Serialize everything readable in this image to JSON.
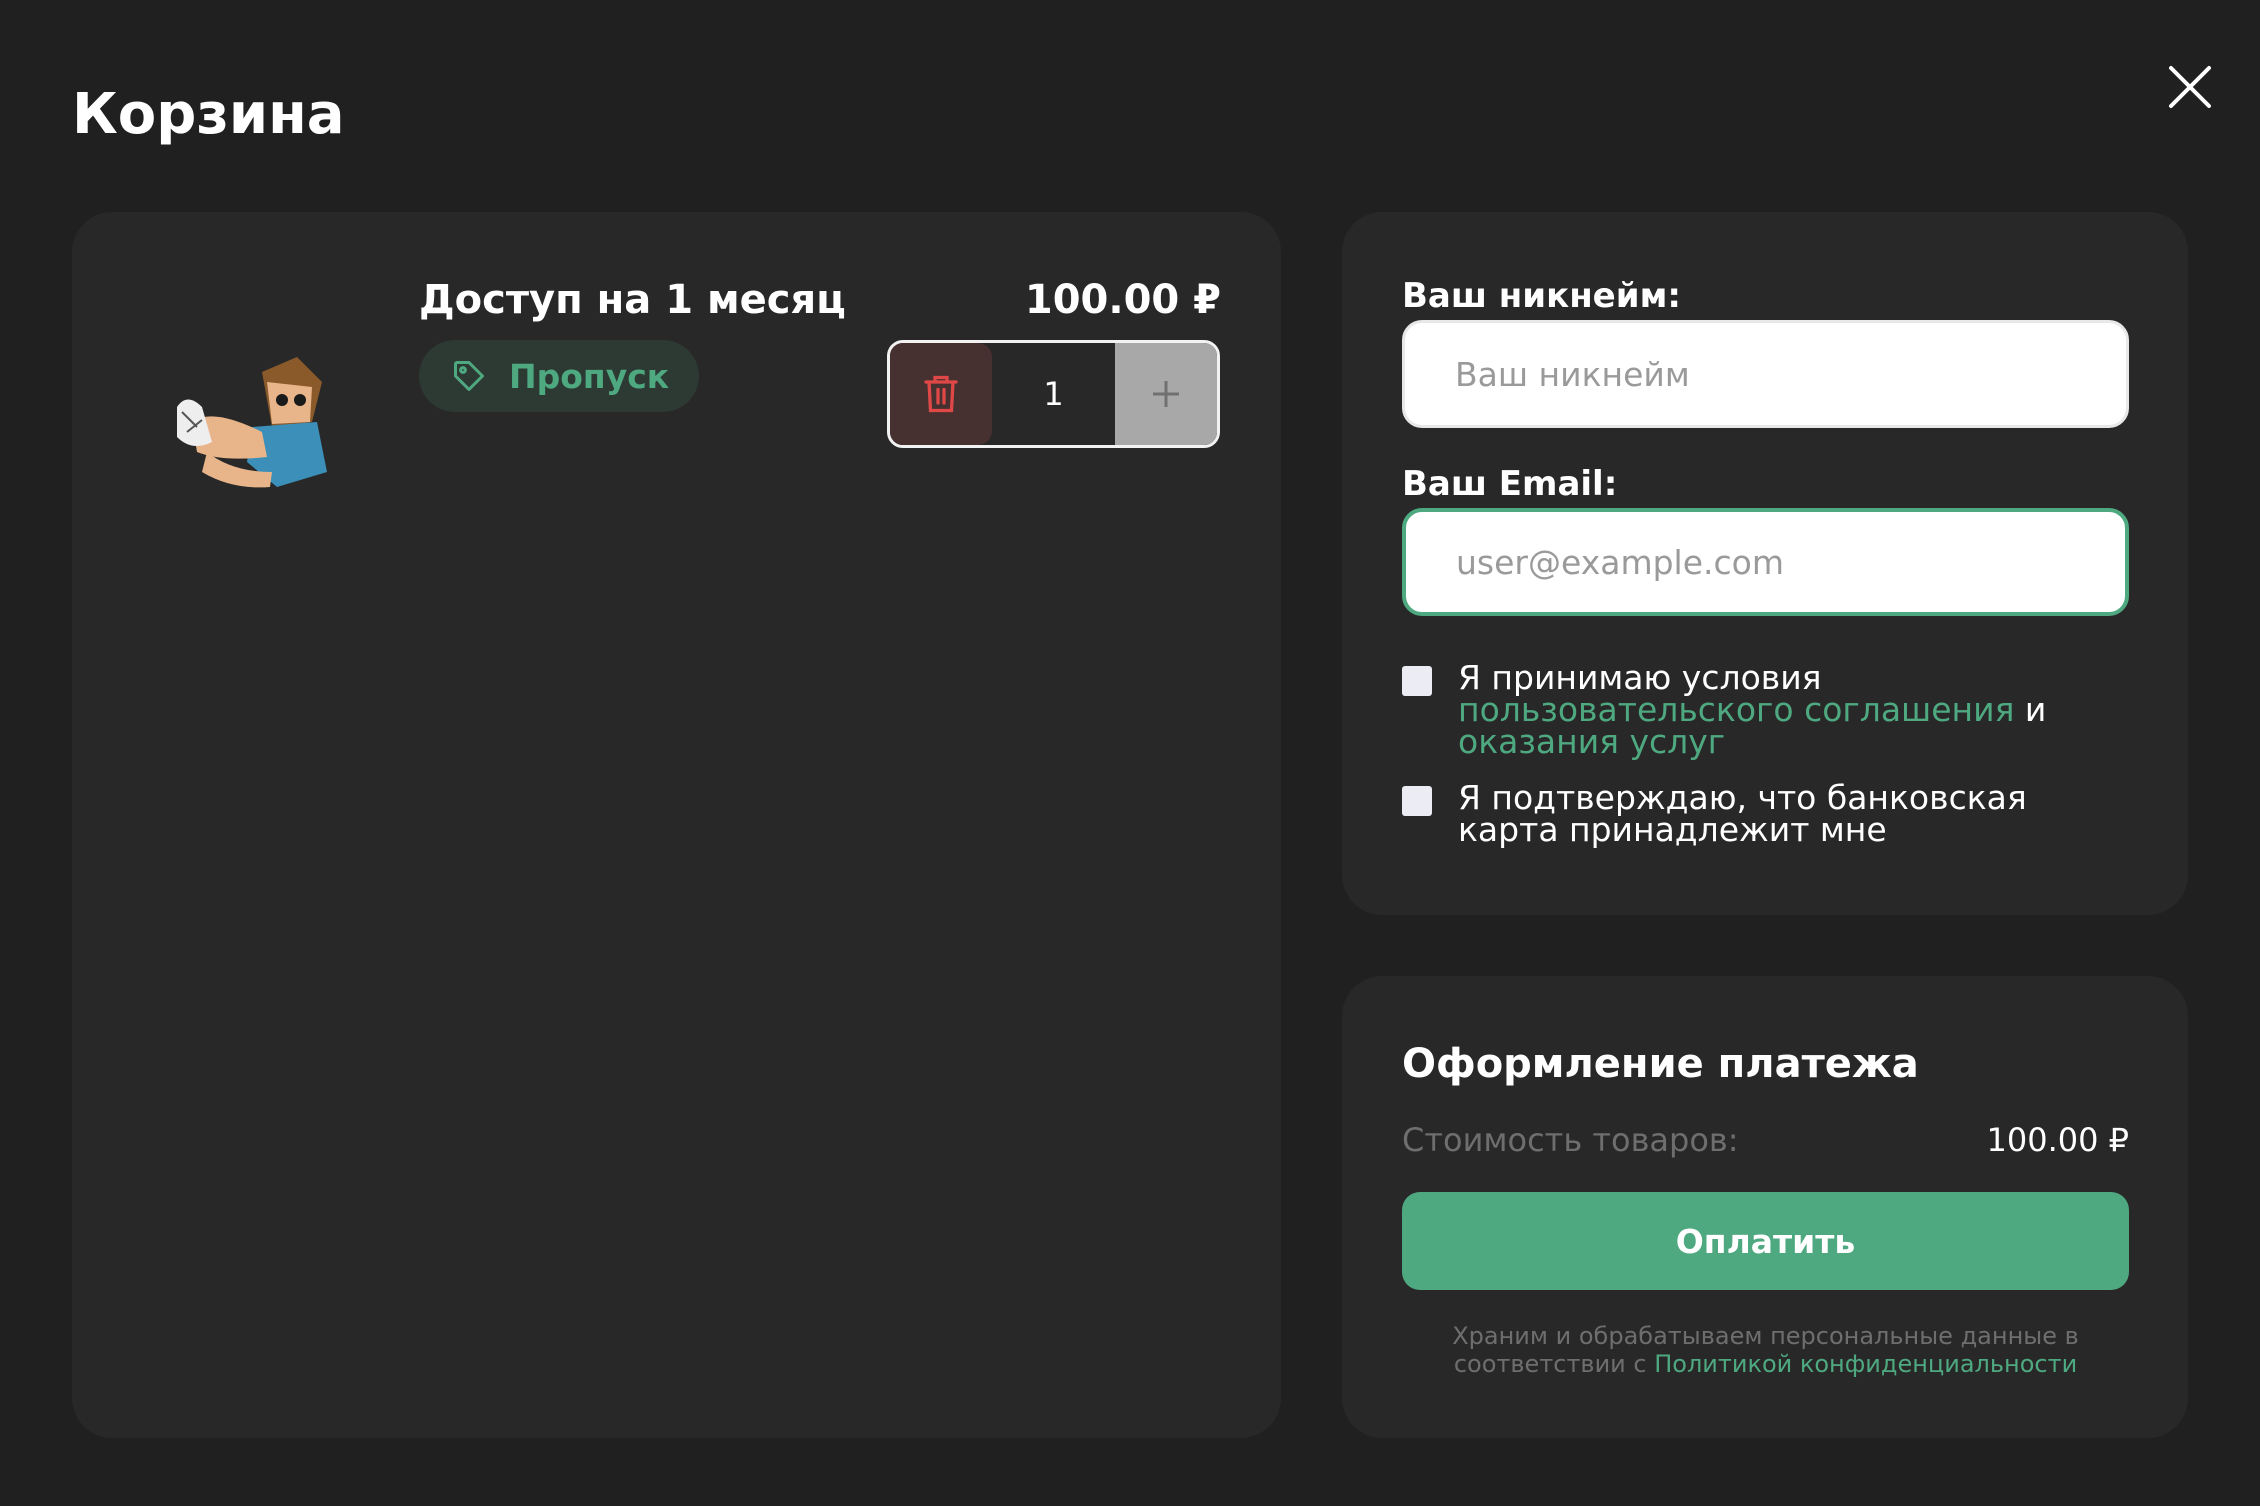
{
  "header": {
    "title": "Корзина"
  },
  "cart": {
    "items": [
      {
        "name": "Доступ на 1 месяц",
        "tag": "Пропуск",
        "price": "100.00 ₽",
        "quantity": "1"
      }
    ]
  },
  "form": {
    "nickname_label": "Ваш никнейм:",
    "nickname_placeholder": "Ваш никнейм",
    "nickname_value": "",
    "email_label": "Ваш Email:",
    "email_placeholder": "user@example.com",
    "email_value": "",
    "terms": {
      "prefix": "Я принимаю условия ",
      "link1": "пользовательского соглашения",
      "middle": " и ",
      "link2": "оказания услуг",
      "checked": false
    },
    "card_confirm": {
      "text": "Я подтверждаю, что банковская карта принадлежит мне",
      "checked": false
    }
  },
  "payment": {
    "title": "Оформление платежа",
    "subtotal_label": "Стоимость товаров:",
    "subtotal_value": "100.00 ₽",
    "pay_button": "Оплатить",
    "privacy_text": "Храним и обрабатываем персональные данные в соответствии с ",
    "privacy_link": "Политикой конфиденциальности"
  },
  "colors": {
    "background": "#202020",
    "card": "#282828",
    "accent": "#4ea880",
    "danger": "#e04848",
    "muted": "#6e6e6e"
  },
  "icons": {
    "close": "close-icon",
    "tag": "tag-icon",
    "delete": "trash-icon",
    "plus": "plus-icon",
    "product": "product-image"
  }
}
